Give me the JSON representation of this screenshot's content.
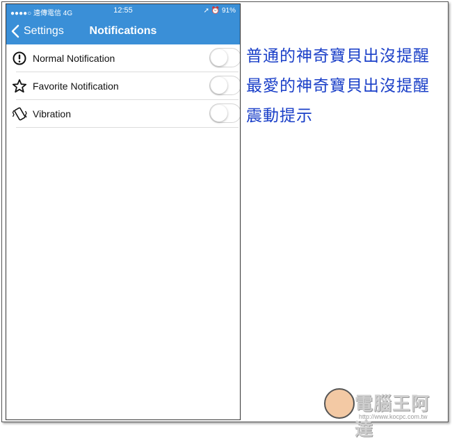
{
  "status_bar": {
    "carrier": "●●●●○ 遠傳電信   4G",
    "time": "12:55",
    "right": "➚ ⏰ 91%"
  },
  "nav": {
    "back_label": "Settings",
    "title": "Notifications"
  },
  "settings": {
    "items": [
      {
        "label": "Normal Notification",
        "icon": "exclamation-circle-icon",
        "enabled": false
      },
      {
        "label": "Favorite Notification",
        "icon": "star-icon",
        "enabled": false
      },
      {
        "label": "Vibration",
        "icon": "vibration-icon",
        "enabled": false
      }
    ]
  },
  "captions": [
    "普通的神奇寶貝出沒提醒",
    "最愛的神奇寶貝出沒提醒",
    "震動提示"
  ],
  "watermark": {
    "brand": "電腦王阿達",
    "url": "http://www.kocpc.com.tw"
  },
  "colors": {
    "nav_bg": "#3a8fd7",
    "caption_text": "#1a3fc8"
  }
}
